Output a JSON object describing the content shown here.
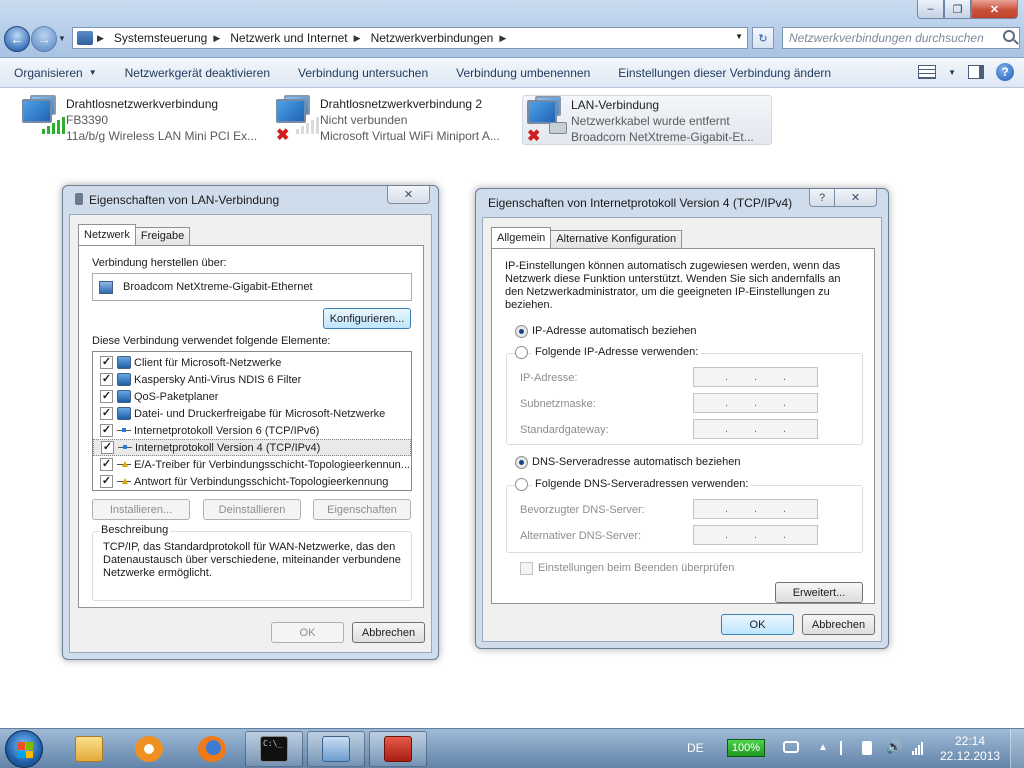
{
  "window": {
    "breadcrumbs": [
      "Systemsteuerung",
      "Netzwerk und Internet",
      "Netzwerkverbindungen"
    ],
    "search_placeholder": "Netzwerkverbindungen durchsuchen"
  },
  "commandbar": {
    "organize": "Organisieren",
    "items": [
      "Netzwerkgerät deaktivieren",
      "Verbindung untersuchen",
      "Verbindung umbenennen",
      "Einstellungen dieser Verbindung ändern"
    ]
  },
  "connections": [
    {
      "name": "Drahtlosnetzwerkverbindung",
      "status": "FB3390",
      "device": "11a/b/g Wireless LAN Mini PCI Ex..."
    },
    {
      "name": "Drahtlosnetzwerkverbindung 2",
      "status": "Nicht verbunden",
      "device": "Microsoft Virtual WiFi Miniport A..."
    },
    {
      "name": "LAN-Verbindung",
      "status": "Netzwerkkabel wurde entfernt",
      "device": "Broadcom NetXtreme-Gigabit-Et..."
    }
  ],
  "lan_dialog": {
    "title": "Eigenschaften von LAN-Verbindung",
    "tabs": [
      "Netzwerk",
      "Freigabe"
    ],
    "connect_using_label": "Verbindung herstellen über:",
    "adapter": "Broadcom NetXtreme-Gigabit-Ethernet",
    "configure": "Konfigurieren...",
    "items_label": "Diese Verbindung verwendet folgende Elemente:",
    "items": [
      "Client für Microsoft-Netzwerke",
      "Kaspersky Anti-Virus NDIS 6 Filter",
      "QoS-Paketplaner",
      "Datei- und Druckerfreigabe für Microsoft-Netzwerke",
      "Internetprotokoll Version 6 (TCP/IPv6)",
      "Internetprotokoll Version 4 (TCP/IPv4)",
      "E/A-Treiber für Verbindungsschicht-Topologieerkennun...",
      "Antwort für Verbindungsschicht-Topologieerkennung"
    ],
    "install": "Installieren...",
    "uninstall": "Deinstallieren",
    "properties": "Eigenschaften",
    "description_label": "Beschreibung",
    "description": "TCP/IP, das Standardprotokoll für WAN-Netzwerke, das den Datenaustausch über verschiedene, miteinander verbundene Netzwerke ermöglicht.",
    "ok": "OK",
    "cancel": "Abbrechen"
  },
  "ipv4_dialog": {
    "title": "Eigenschaften von Internetprotokoll Version 4 (TCP/IPv4)",
    "help": "?",
    "tabs": [
      "Allgemein",
      "Alternative Konfiguration"
    ],
    "intro": "IP-Einstellungen können automatisch zugewiesen werden, wenn das Netzwerk diese Funktion unterstützt. Wenden Sie sich andernfalls an den Netzwerkadministrator, um die geeigneten IP-Einstellungen zu beziehen.",
    "auto_ip": "IP-Adresse automatisch beziehen",
    "manual_ip": "Folgende IP-Adresse verwenden:",
    "ip_address": "IP-Adresse:",
    "subnet": "Subnetzmaske:",
    "gateway": "Standardgateway:",
    "auto_dns": "DNS-Serveradresse automatisch beziehen",
    "manual_dns": "Folgende DNS-Serveradressen verwenden:",
    "preferred_dns": "Bevorzugter DNS-Server:",
    "alternate_dns": "Alternativer DNS-Server:",
    "validate": "Einstellungen beim Beenden überprüfen",
    "advanced": "Erweitert...",
    "ok": "OK",
    "cancel": "Abbrechen"
  },
  "taskbar": {
    "language": "DE",
    "battery": "100%",
    "time": "22:14",
    "date": "22.12.2013"
  }
}
